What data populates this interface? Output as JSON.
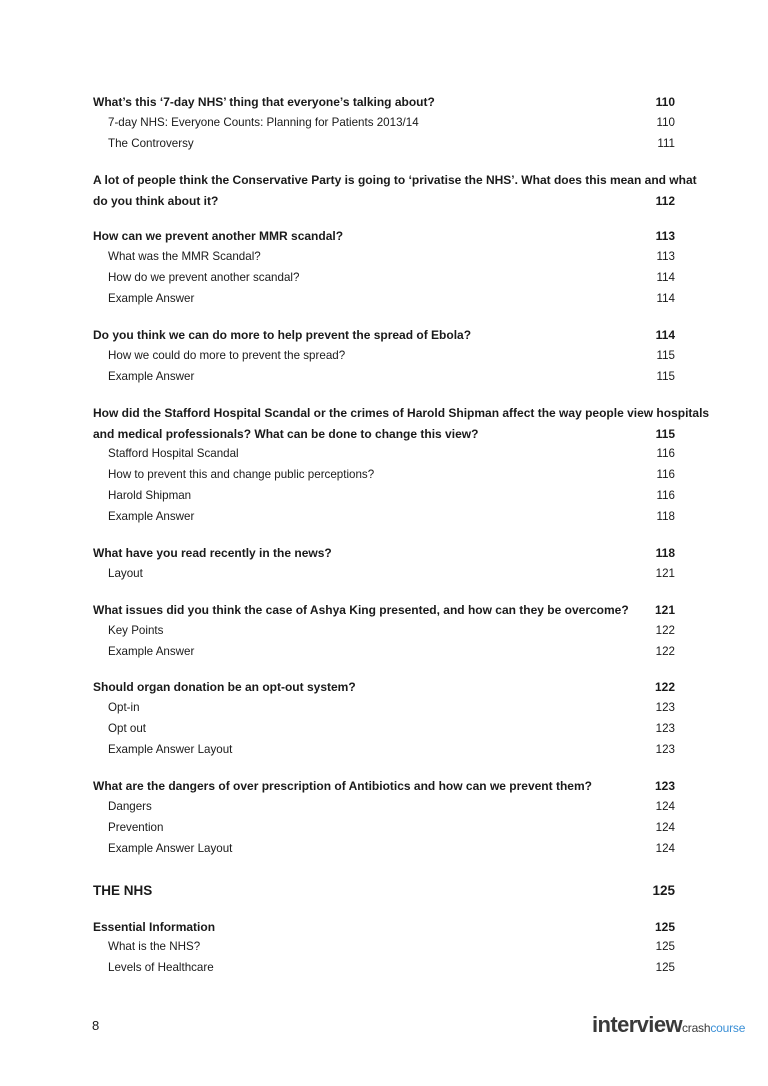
{
  "sections": [
    {
      "title": "What’s this ‘7-day NHS’ thing that everyone’s talking about?",
      "page": "110",
      "subs": [
        {
          "title": "7-day NHS: Everyone Counts: Planning for Patients 2013/14",
          "page": "110"
        },
        {
          "title": "The Controversy",
          "page": "111"
        }
      ]
    },
    {
      "title_line1": "A lot of people think the Conservative Party is going to ‘privatise the NHS’. What does this mean and what",
      "title": "do you think about it?",
      "page": "112",
      "subs": []
    },
    {
      "title": "How can we prevent another MMR scandal?",
      "page": "113",
      "subs": [
        {
          "title": "What was the MMR Scandal?",
          "page": "113"
        },
        {
          "title": "How do we prevent another scandal?",
          "page": "114"
        },
        {
          "title": "Example Answer",
          "page": "114"
        }
      ]
    },
    {
      "title": "Do you think we can do more to help prevent the spread of Ebola?",
      "page": "114",
      "subs": [
        {
          "title": "How we could do more to prevent the spread?",
          "page": "115"
        },
        {
          "title": "Example Answer",
          "page": "115"
        }
      ]
    },
    {
      "title_line1": "How did the Stafford Hospital Scandal or the crimes of Harold Shipman affect the way people view hospitals",
      "title": "and medical professionals? What can be done to change this view?",
      "page": "115",
      "subs": [
        {
          "title": "Stafford Hospital Scandal",
          "page": "116"
        },
        {
          "title": "How to prevent this and change public perceptions?",
          "page": "116"
        },
        {
          "title": "Harold Shipman",
          "page": "116"
        },
        {
          "title": "Example Answer",
          "page": "118"
        }
      ]
    },
    {
      "title": "What have you read recently in the news?",
      "page": "118",
      "subs": [
        {
          "title": "Layout",
          "page": "121"
        }
      ]
    },
    {
      "title": "What issues did you think the case of Ashya King presented, and how can they be overcome?",
      "page": "121",
      "subs": [
        {
          "title": "Key Points",
          "page": "122"
        },
        {
          "title": "Example Answer",
          "page": "122"
        }
      ]
    },
    {
      "title": "Should organ donation be an opt-out system?",
      "page": "122",
      "subs": [
        {
          "title": "Opt-in",
          "page": "123"
        },
        {
          "title": "Opt out",
          "page": "123"
        },
        {
          "title": "Example Answer Layout",
          "page": "123"
        }
      ]
    },
    {
      "title": "What are the dangers of over prescription of Antibiotics and how can we prevent them?",
      "page": "123",
      "subs": [
        {
          "title": "Dangers",
          "page": "124"
        },
        {
          "title": "Prevention",
          "page": "124"
        },
        {
          "title": "Example Answer Layout",
          "page": "124"
        }
      ]
    }
  ],
  "chapter": {
    "title": "THE NHS",
    "page": "125"
  },
  "essential": {
    "title": "Essential Information",
    "page": "125",
    "subs": [
      {
        "title": "What is the NHS?",
        "page": "125"
      },
      {
        "title": "Levels of Healthcare",
        "page": "125"
      }
    ]
  },
  "footer": {
    "page_number": "8",
    "logo_main": "interview",
    "logo_crash": "crash",
    "logo_course": "course"
  }
}
